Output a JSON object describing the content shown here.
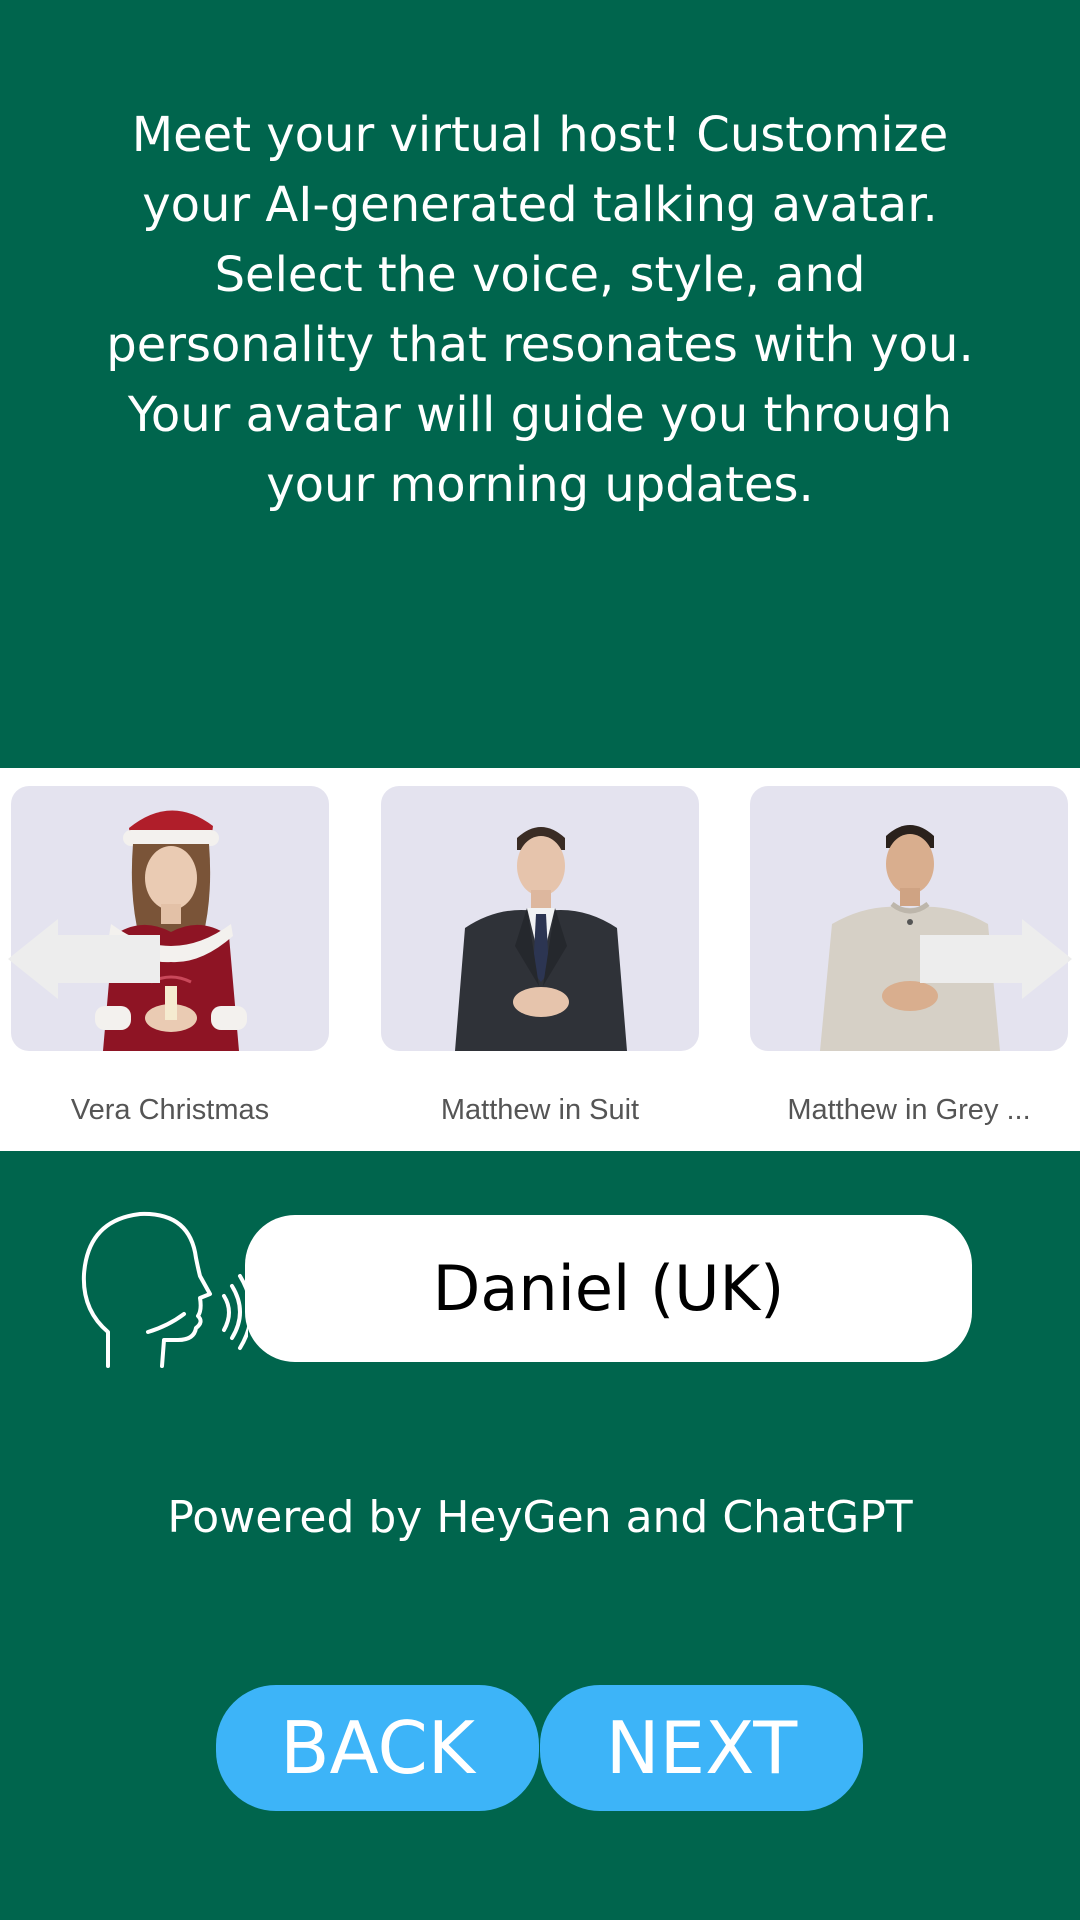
{
  "intro": {
    "text": "Meet your virtual host! Customize your AI-generated talking avatar. Select the voice, style, and personality that resonates with you. Your avatar will guide you through your morning updates."
  },
  "avatars": [
    {
      "name": "Vera Christmas",
      "icon": "avatar-vera-christmas-image"
    },
    {
      "name": "Matthew in Suit",
      "icon": "avatar-matthew-suit-image"
    },
    {
      "name": "Matthew in Grey ...",
      "icon": "avatar-matthew-grey-image"
    }
  ],
  "carousel": {
    "prev_icon": "arrow-left-icon",
    "next_icon": "arrow-right-icon"
  },
  "voice": {
    "icon": "speaking-head-icon",
    "selected": "Daniel (UK)"
  },
  "footer": {
    "powered_by": "Powered by HeyGen and ChatGPT"
  },
  "nav": {
    "back_label": "BACK",
    "next_label": "NEXT"
  },
  "colors": {
    "background": "#00654D",
    "button": "#3DB4F8",
    "card": "#E4E3EF"
  }
}
